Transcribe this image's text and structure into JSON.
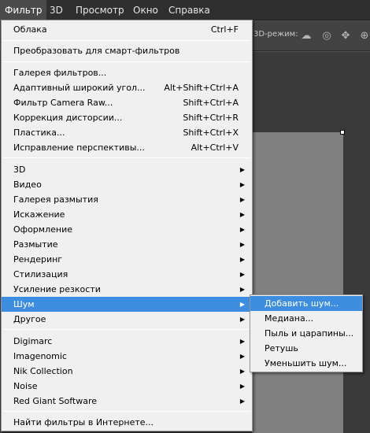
{
  "menubar": {
    "items": [
      "Фильтр",
      "3D",
      "Просмотр",
      "Окно",
      "Справка"
    ]
  },
  "options_bar": {
    "mode_label": "3D-режим:"
  },
  "filter_menu": {
    "last_filter": {
      "label": "Облака",
      "shortcut": "Ctrl+F"
    },
    "smart": "Преобразовать для смарт-фильтров",
    "gallery": "Галерея фильтров...",
    "adaptive": {
      "label": "Адаптивный широкий угол...",
      "shortcut": "Alt+Shift+Ctrl+A"
    },
    "camera_raw": {
      "label": "Фильтр Camera Raw...",
      "shortcut": "Shift+Ctrl+A"
    },
    "lens": {
      "label": "Коррекция дисторсии...",
      "shortcut": "Shift+Ctrl+R"
    },
    "liquify": {
      "label": "Пластика...",
      "shortcut": "Shift+Ctrl+X"
    },
    "vanishing": {
      "label": "Исправление перспективы...",
      "shortcut": "Alt+Ctrl+V"
    },
    "groups": [
      "3D",
      "Видео",
      "Галерея размытия",
      "Искажение",
      "Оформление",
      "Размытие",
      "Рендеринг",
      "Стилизация",
      "Усиление резкости",
      "Шум",
      "Другое"
    ],
    "plugins": [
      "Digimarc",
      "Imagenomic",
      "Nik Collection",
      "Noise",
      "Red Giant Software"
    ],
    "browse": "Найти фильтры в Интернете..."
  },
  "noise_submenu": {
    "items": [
      "Добавить шум...",
      "Медиана...",
      "Пыль и царапины...",
      "Ретушь",
      "Уменьшить шум..."
    ]
  }
}
